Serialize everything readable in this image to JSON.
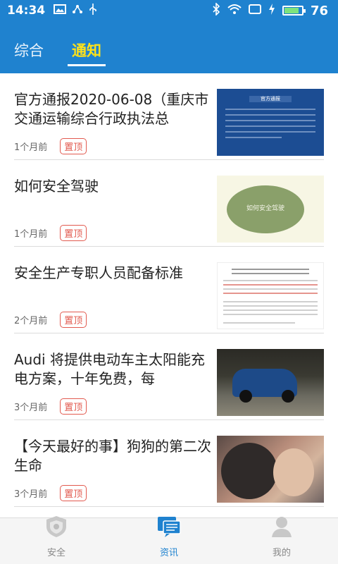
{
  "status_bar": {
    "time": "14:34",
    "battery": "76",
    "battery_level": 0.76
  },
  "header": {
    "tabs": [
      {
        "label": "综合",
        "active": false
      },
      {
        "label": "通知",
        "active": true
      }
    ]
  },
  "articles": [
    {
      "title": "官方通报2020-06-08（重庆市交通运输综合行政执法总",
      "time": "1个月前",
      "badge": "置顶",
      "thumb_text": "官方通报"
    },
    {
      "title": "如何安全驾驶",
      "time": "1个月前",
      "badge": "置顶",
      "thumb_text": "如何安全驾驶"
    },
    {
      "title": "安全生产专职人员配备标准",
      "time": "2个月前",
      "badge": "置顶",
      "thumb_text": ""
    },
    {
      "title": "Audi 将提供电动车主太阳能充电方案，十年免费，每",
      "time": "3个月前",
      "badge": "置顶",
      "thumb_text": ""
    },
    {
      "title": "【今天最好的事】狗狗的第二次生命",
      "time": "3个月前",
      "badge": "置顶",
      "thumb_text": ""
    }
  ],
  "bottom_nav": [
    {
      "label": "安全",
      "icon": "shield-icon",
      "active": false
    },
    {
      "label": "资讯",
      "icon": "news-chat-icon",
      "active": true
    },
    {
      "label": "我的",
      "icon": "user-icon",
      "active": false
    }
  ],
  "colors": {
    "brand": "#1f82cf",
    "tab_active": "#ffe21a",
    "badge": "#e25a4f"
  }
}
